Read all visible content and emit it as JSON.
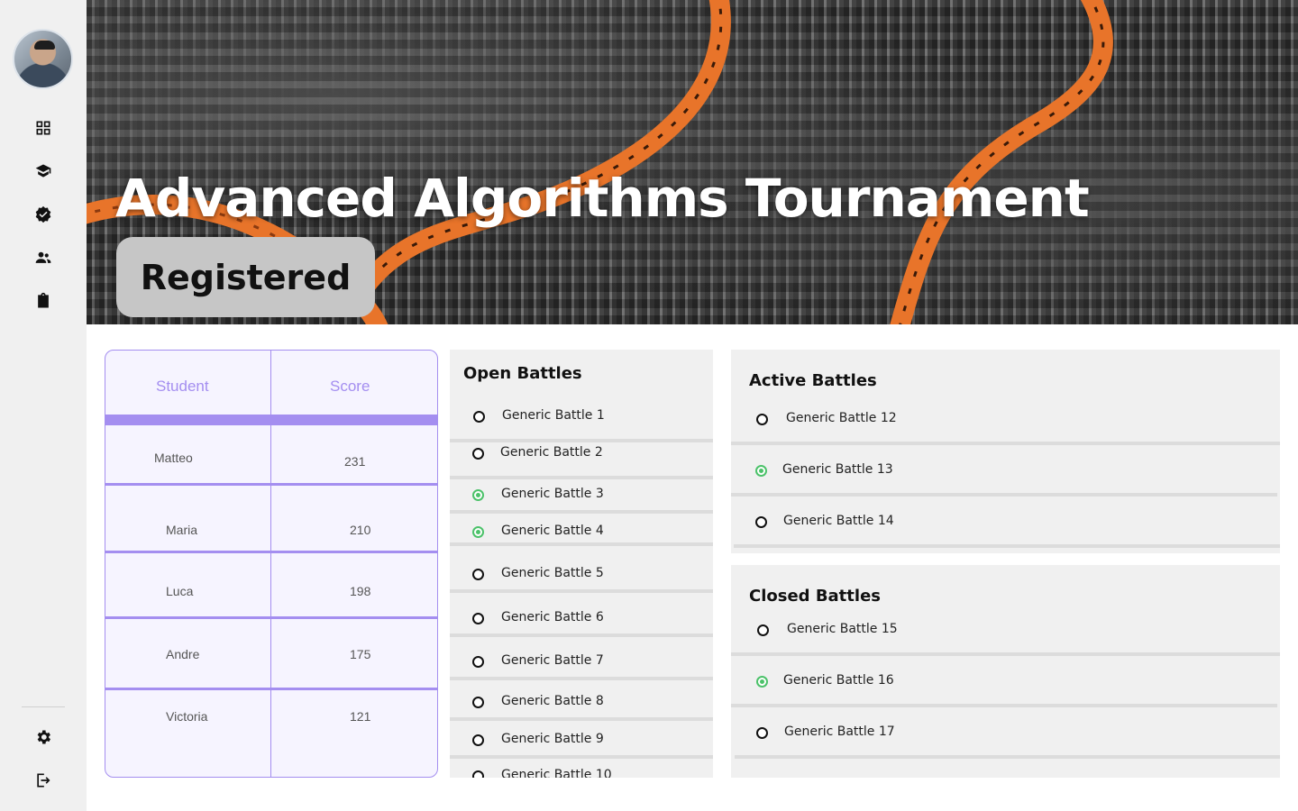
{
  "hero": {
    "title": "Advanced Algorithms Tournament",
    "status_badge": "Registered"
  },
  "sidebar": {
    "icons": [
      "dashboard-icon",
      "school-icon",
      "verified-icon",
      "group-icon",
      "assignment-icon",
      "settings-icon",
      "logout-icon"
    ]
  },
  "leaderboard": {
    "headers": {
      "student": "Student",
      "score": "Score"
    },
    "rows": [
      {
        "student": "Matteo",
        "score": "231"
      },
      {
        "student": "Maria",
        "score": "210"
      },
      {
        "student": "Luca",
        "score": "198"
      },
      {
        "student": "Andre",
        "score": "175"
      },
      {
        "student": "Victoria",
        "score": "121"
      }
    ]
  },
  "open_battles": {
    "title": "Open Battles",
    "items": [
      {
        "label": "Generic Battle 1",
        "selected": false
      },
      {
        "label": "Generic Battle 2",
        "selected": false
      },
      {
        "label": "Generic Battle 3",
        "selected": true
      },
      {
        "label": "Generic Battle 4",
        "selected": true
      },
      {
        "label": "Generic Battle 5",
        "selected": false
      },
      {
        "label": "Generic Battle 6",
        "selected": false
      },
      {
        "label": "Generic Battle 7",
        "selected": false
      },
      {
        "label": "Generic Battle 8",
        "selected": false
      },
      {
        "label": "Generic Battle 9",
        "selected": false
      },
      {
        "label": "Generic Battle 10",
        "selected": false
      }
    ]
  },
  "active_battles": {
    "title": "Active Battles",
    "items": [
      {
        "label": "Generic Battle 12",
        "selected": false
      },
      {
        "label": "Generic Battle 13",
        "selected": true
      },
      {
        "label": "Generic Battle 14",
        "selected": false
      }
    ]
  },
  "closed_battles": {
    "title": "Closed Battles",
    "items": [
      {
        "label": "Generic Battle 15",
        "selected": false
      },
      {
        "label": "Generic Battle 16",
        "selected": true
      },
      {
        "label": "Generic Battle 17",
        "selected": false
      }
    ]
  },
  "colors": {
    "accent": "#a48ef0",
    "selected": "#4cc26a",
    "rope": "#e8742a"
  }
}
